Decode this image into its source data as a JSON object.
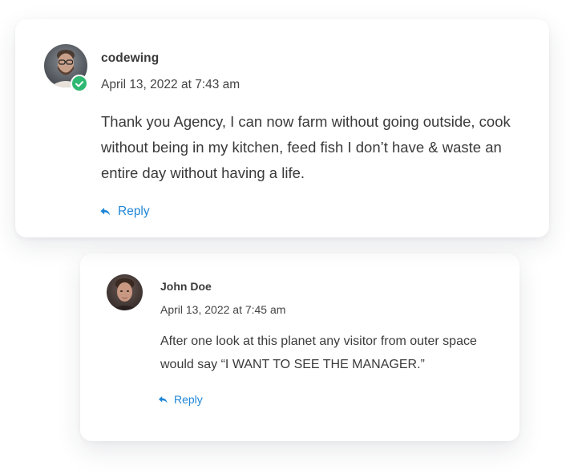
{
  "comments": [
    {
      "author": "codewing",
      "date": "April 13, 2022 at 7:43 am",
      "text": "Thank you Agency, I can now farm without going outside, cook without being in my kitchen, feed fish I don’t have & waste an entire day without having a life.",
      "reply_label": "Reply",
      "verified": true,
      "avatar": "man-with-glasses-beard-avatar"
    }
  ],
  "replies": [
    {
      "author": "John Doe",
      "date": "April 13, 2022 at 7:45 am",
      "text": "After one look at this planet any visitor from outer space would say “I WANT TO SEE THE MANAGER.”",
      "reply_label": "Reply",
      "avatar": "young-man-portrait-avatar"
    }
  ],
  "icons": {
    "reply": "reply-arrow-icon",
    "verified": "check-badge-icon"
  },
  "colors": {
    "link": "#1f86d6",
    "verified_badge": "#2eb872",
    "text": "#3a3a3a",
    "background": "#ffffff"
  }
}
